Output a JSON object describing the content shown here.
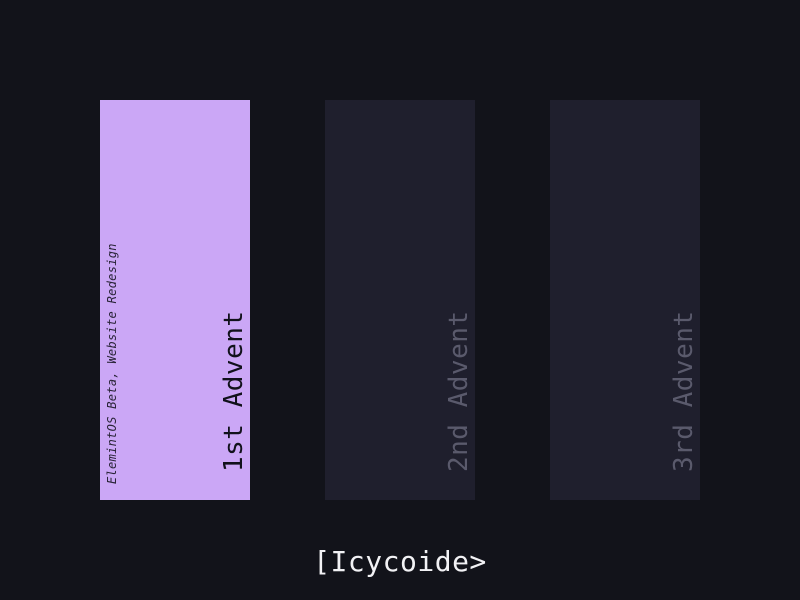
{
  "panels": [
    {
      "title": "1st Advent",
      "subtitle": "ElemintOS Beta, Website Redesign",
      "active": true
    },
    {
      "title": "2nd Advent",
      "subtitle": "",
      "active": false
    },
    {
      "title": "3rd Advent",
      "subtitle": "",
      "active": false
    }
  ],
  "logo": {
    "text": "[Icycoide>"
  },
  "colors": {
    "background": "#12131a",
    "active_panel": "#cba7f6",
    "inactive_panel": "#1f1f2d",
    "inactive_text": "#5a5a6c",
    "logo_text": "#f2f2f5"
  }
}
